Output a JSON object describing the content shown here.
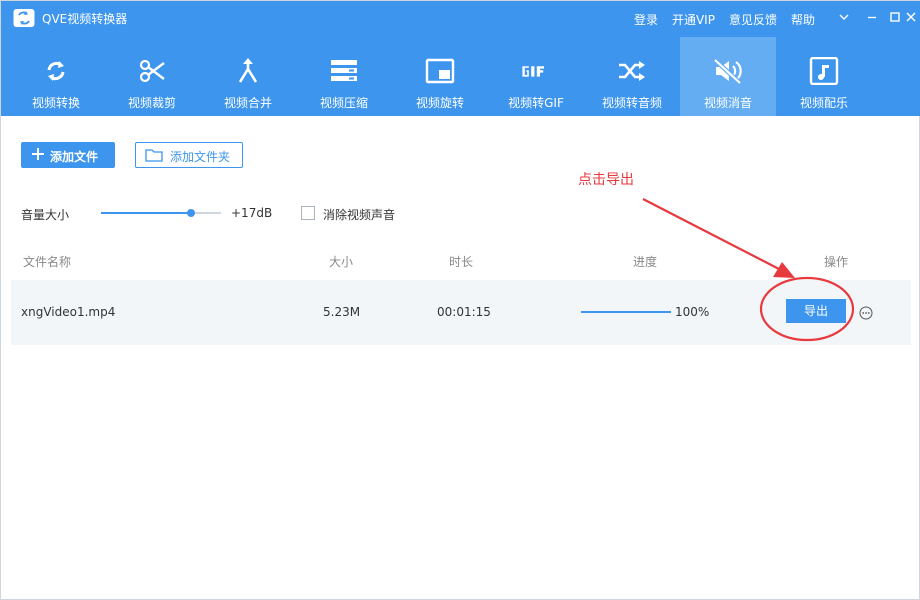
{
  "app": {
    "title": "QVE视频转换器"
  },
  "top_links": [
    "登录",
    "开通VIP",
    "意见反馈",
    "帮助"
  ],
  "tools": [
    {
      "label": "视频转换",
      "icon": "refresh-icon"
    },
    {
      "label": "视频裁剪",
      "icon": "scissors-icon"
    },
    {
      "label": "视频合并",
      "icon": "merge-icon"
    },
    {
      "label": "视频压缩",
      "icon": "compress-icon"
    },
    {
      "label": "视频旋转",
      "icon": "rotate-icon"
    },
    {
      "label": "视频转GIF",
      "icon": "gif-icon"
    },
    {
      "label": "视频转音频",
      "icon": "shuffle-icon"
    },
    {
      "label": "视频消音",
      "icon": "mute-icon",
      "active": true
    },
    {
      "label": "视频配乐",
      "icon": "music-icon"
    }
  ],
  "actions": {
    "add_file": "添加文件",
    "add_folder": "添加文件夹"
  },
  "volume": {
    "label": "音量大小",
    "value": "+17dB",
    "level": 0.75,
    "mute_label": "消除视频声音"
  },
  "table": {
    "headers": {
      "name": "文件名称",
      "size": "大小",
      "duration": "时长",
      "progress": "进度",
      "actions": "操作"
    },
    "rows": [
      {
        "name": "xngVideo1.mp4",
        "size": "5.23M",
        "duration": "00:01:15",
        "progress_text": "100%",
        "progress": 1.0,
        "export": "导出"
      }
    ]
  },
  "annotation": {
    "text": "点击导出"
  },
  "colors": {
    "primary": "#3d95ee",
    "active_tab": "#64adf3",
    "annotation": "#e8393e"
  }
}
